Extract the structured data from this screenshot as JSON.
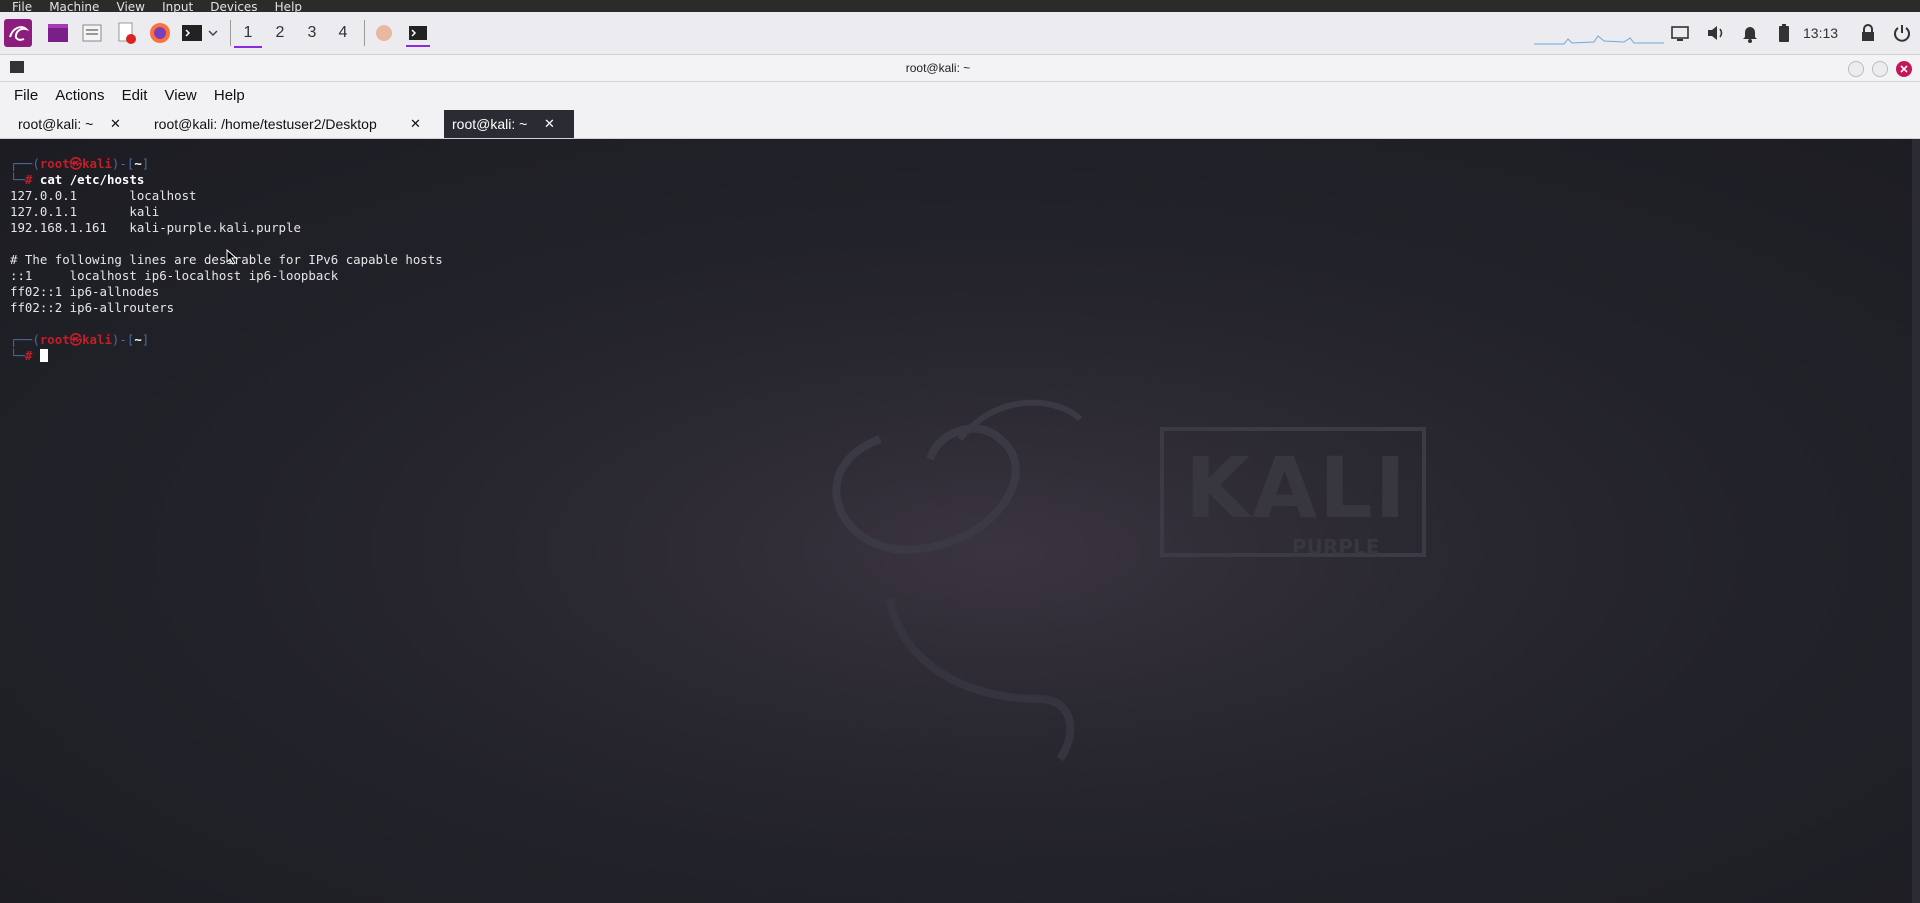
{
  "vm_menu": [
    "File",
    "Machine",
    "View",
    "Input",
    "Devices",
    "Help"
  ],
  "panel": {
    "workspaces": [
      "1",
      "2",
      "3",
      "4"
    ],
    "active_workspace": "1",
    "clock": "13:13",
    "icons": [
      "kali-menu-icon",
      "terminal-app-icon",
      "files-icon",
      "text-editor-icon",
      "firefox-icon",
      "terminal-icon",
      "network-icon",
      "volume-icon",
      "notifications-icon",
      "battery-icon",
      "lock-icon",
      "power-icon"
    ]
  },
  "window": {
    "title": "root@kali: ~",
    "menu": [
      "File",
      "Actions",
      "Edit",
      "View",
      "Help"
    ],
    "tabs": [
      {
        "label": "root@kali: ~",
        "close": "✕"
      },
      {
        "label": "root@kali: /home/testuser2/Desktop",
        "close": "✕"
      },
      {
        "label": "root@kali: ~",
        "close": "✕"
      }
    ]
  },
  "terminal": {
    "prompt_user": "root㉿kali",
    "prompt_dir": "~",
    "command": "cat /etc/hosts",
    "output": [
      "127.0.0.1       localhost",
      "127.0.1.1       kali",
      "192.168.1.161   kali-purple.kali.purple",
      "",
      "# The following lines are desirable for IPv6 capable hosts",
      "::1     localhost ip6-localhost ip6-loopback",
      "ff02::1 ip6-allnodes",
      "ff02::2 ip6-allrouters"
    ],
    "prompt_hash": "#"
  },
  "wallpaper": {
    "logo_text": "KALI",
    "logo_subtext": "PURPLE"
  }
}
